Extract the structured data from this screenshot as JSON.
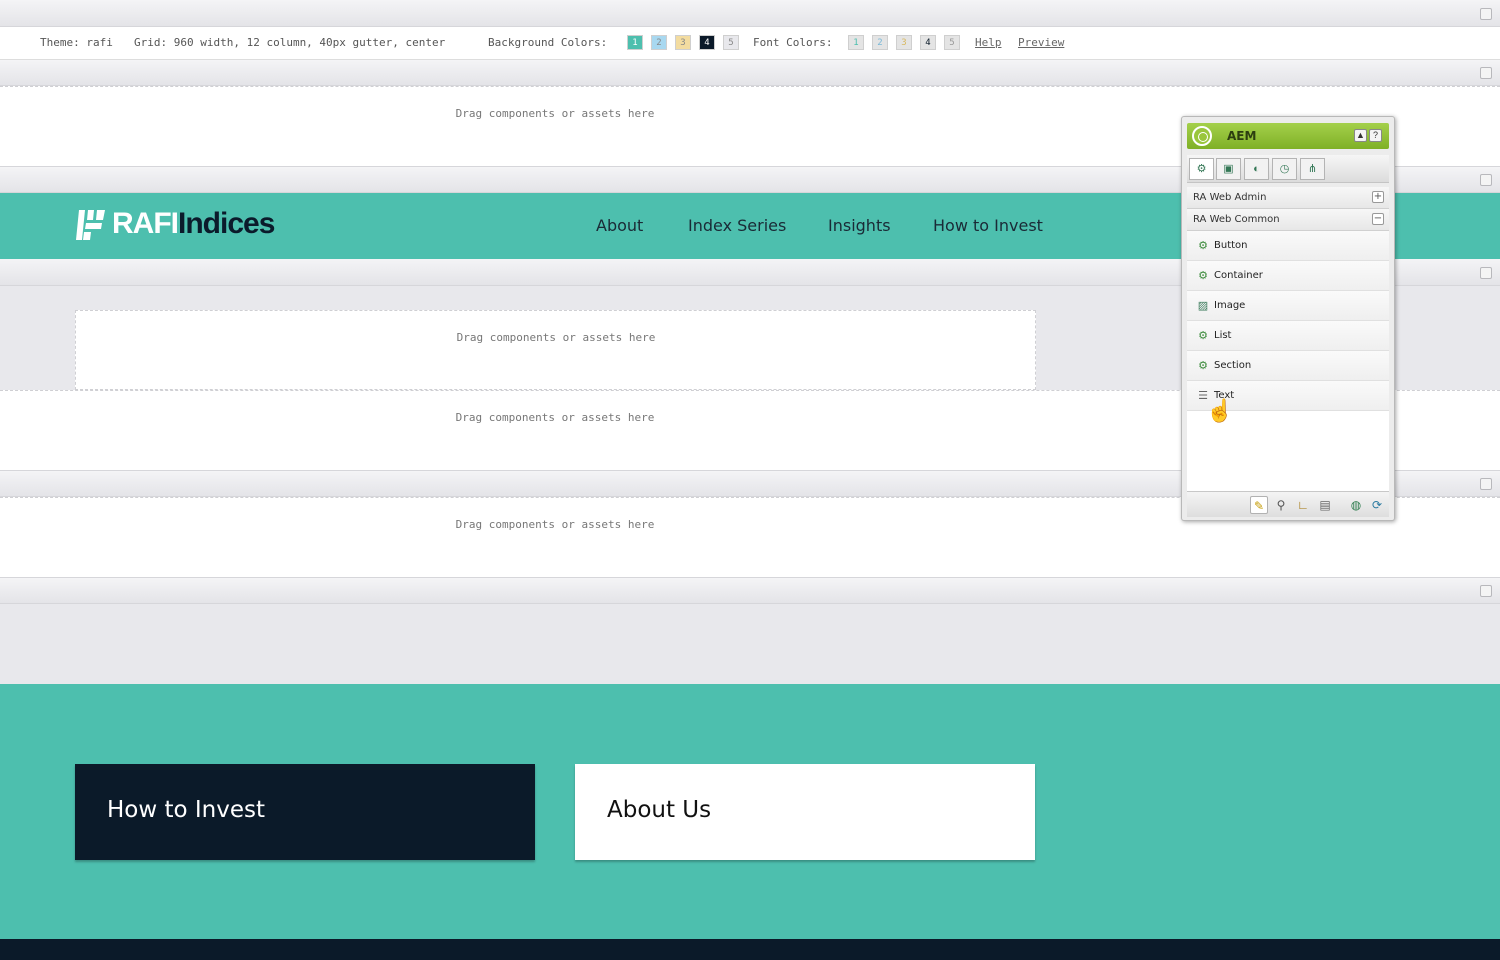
{
  "toolbar": {
    "theme": "Theme: rafi",
    "grid": "Grid: 960 width, 12 column, 40px gutter, center",
    "bg_label": "Background Colors:",
    "bg_swatches": [
      {
        "label": "1",
        "color": "#4dbfae"
      },
      {
        "label": "2",
        "color": "#a8d8f0"
      },
      {
        "label": "3",
        "color": "#f3dca0"
      },
      {
        "label": "4",
        "color": "#0b1a29"
      },
      {
        "label": "5",
        "color": "#e8e8ec"
      }
    ],
    "font_label": "Font Colors:",
    "font_swatches": [
      {
        "label": "1"
      },
      {
        "label": "2"
      },
      {
        "label": "3"
      },
      {
        "label": "4"
      },
      {
        "label": "5"
      }
    ],
    "help": "Help",
    "preview": "Preview"
  },
  "drop_text": "Drag components or assets here",
  "header": {
    "logo_part1": "RAFI",
    "logo_part2": "Indices",
    "nav": [
      "About",
      "Index Series",
      "Insights",
      "How to Invest"
    ]
  },
  "cards": [
    {
      "title": "How to Invest",
      "bg": "#0b1a29",
      "fg": "#ffffff"
    },
    {
      "title": "About Us",
      "bg": "#ffffff",
      "fg": "#111111"
    }
  ],
  "sidekick": {
    "title": "AEM",
    "tab_icons": [
      "components-icon",
      "page-icon",
      "workflow-icon",
      "versions-icon",
      "sitemap-icon"
    ],
    "groups": [
      {
        "label": "RA Web Admin",
        "toggle": "+"
      },
      {
        "label": "RA Web Common",
        "toggle": "−"
      }
    ],
    "components": [
      {
        "label": "Button",
        "icon": "component-icon"
      },
      {
        "label": "Container",
        "icon": "component-icon"
      },
      {
        "label": "Image",
        "icon": "image-icon"
      },
      {
        "label": "List",
        "icon": "component-icon"
      },
      {
        "label": "Section",
        "icon": "component-icon"
      },
      {
        "label": "Text",
        "icon": "text-icon"
      }
    ]
  },
  "colors": {
    "teal": "#4dbfae",
    "navy": "#0b1a29",
    "aem_green": "#8cbd2f"
  }
}
